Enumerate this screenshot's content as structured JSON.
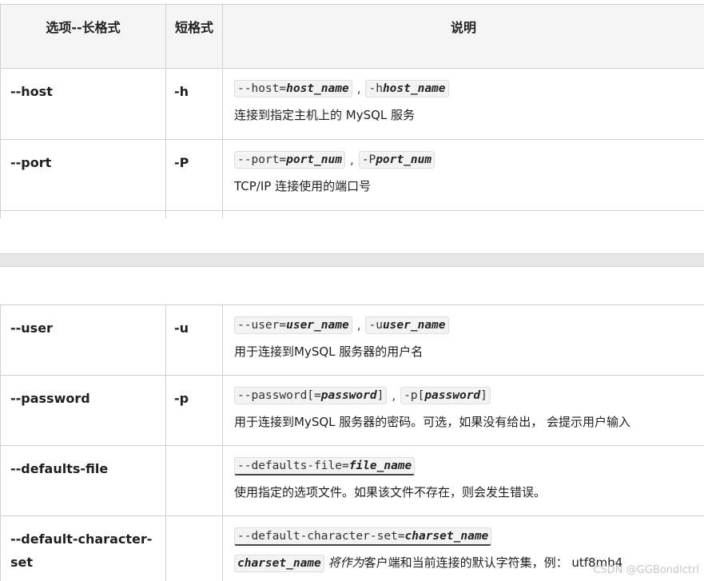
{
  "headers": [
    "选项--长格式",
    "短格式",
    "说明"
  ],
  "rows": [
    {
      "long": "--host",
      "short": "-h",
      "syntax": [
        {
          "prefix": "--host=",
          "var": "host_name",
          "suffix": ""
        },
        {
          "prefix": "-h",
          "var": "host_name",
          "suffix": ""
        }
      ],
      "sep": ",",
      "desc": "连接到指定主机上的 MySQL 服务"
    },
    {
      "long": "--port",
      "short": "-P",
      "syntax": [
        {
          "prefix": "--port=",
          "var": "port_num",
          "suffix": ""
        },
        {
          "prefix": "-P",
          "var": "port_num",
          "suffix": ""
        }
      ],
      "sep": ",",
      "desc": "TCP/IP 连接使用的端口号"
    },
    {
      "long": "--user",
      "short": "-u",
      "syntax": [
        {
          "prefix": "--user=",
          "var": "user_name",
          "suffix": ""
        },
        {
          "prefix": "-u",
          "var": "user_name",
          "suffix": ""
        }
      ],
      "sep": ",",
      "desc": "用于连接到MySQL 服务器的用户名"
    },
    {
      "long": "--password",
      "short": "-p",
      "syntax": [
        {
          "prefix": "--password[=",
          "var": "password",
          "suffix": "]"
        },
        {
          "prefix": "-p[",
          "var": "password",
          "suffix": "]"
        }
      ],
      "sep": ",",
      "desc": "用于连接到MySQL 服务器的密码。可选，如果没有给出， 会提示用户输入"
    },
    {
      "long": "--defaults-file",
      "short": "",
      "syntax": [
        {
          "prefix": "--defaults-file=",
          "var": "file_name",
          "suffix": ""
        }
      ],
      "desc": "使用指定的选项文件。如果该文件不存在，则会发生错误。"
    },
    {
      "long_line1": "--default-character-",
      "long_line2": "set",
      "short": "",
      "syntax": [
        {
          "prefix": "--default-character-set=",
          "var": "charset_name",
          "suffix": ""
        }
      ],
      "desc_code": "charset_name",
      "desc_em": "将作为",
      "desc": "客户端和当前连接的默认字符集，例： utf8mb4"
    }
  ],
  "watermark": "CSDN @GGBondlctrl"
}
